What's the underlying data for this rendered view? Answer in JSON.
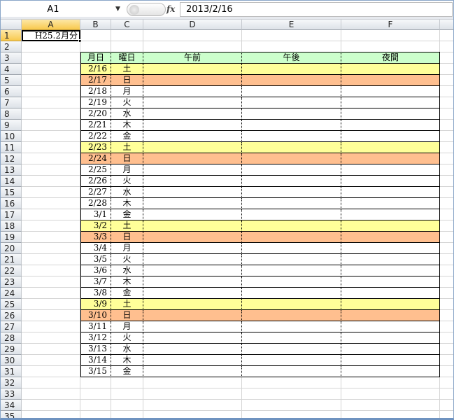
{
  "formula_bar": {
    "name_box": "A1",
    "fx_label": "fx",
    "value": "2013/2/16"
  },
  "columns": [
    "A",
    "B",
    "C",
    "D",
    "E",
    "F",
    ""
  ],
  "rows": [
    "1",
    "2",
    "3",
    "4",
    "5",
    "6",
    "7",
    "8",
    "9",
    "10",
    "11",
    "12",
    "13",
    "14",
    "15",
    "16",
    "17",
    "18",
    "19",
    "20",
    "21",
    "22",
    "23",
    "24",
    "25",
    "26",
    "27",
    "28",
    "29",
    "30",
    "31",
    "32",
    "33",
    "34",
    "35"
  ],
  "a1": "H25.2月分",
  "table": {
    "headers": [
      "月日",
      "曜日",
      "午前",
      "午後",
      "夜間"
    ],
    "dates": [
      "2/16",
      "2/17",
      "2/18",
      "2/19",
      "2/20",
      "2/21",
      "2/22",
      "2/23",
      "2/24",
      "2/25",
      "2/26",
      "2/27",
      "2/28",
      "3/1",
      "3/2",
      "3/3",
      "3/4",
      "3/5",
      "3/6",
      "3/7",
      "3/8",
      "3/9",
      "3/10",
      "3/11",
      "3/12",
      "3/13",
      "3/14",
      "3/15"
    ],
    "days": [
      "土",
      "日",
      "月",
      "火",
      "水",
      "木",
      "金",
      "土",
      "日",
      "月",
      "火",
      "水",
      "木",
      "金",
      "土",
      "日",
      "月",
      "火",
      "水",
      "木",
      "金",
      "土",
      "日",
      "月",
      "火",
      "水",
      "木",
      "金"
    ]
  },
  "colors": {
    "header": "#ccffcc",
    "saturday": "#ffff99",
    "sunday": "#ffbf8f"
  }
}
